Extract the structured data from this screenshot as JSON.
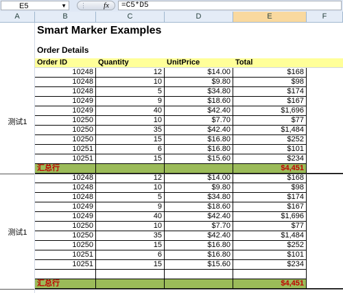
{
  "namebox": "E5",
  "formula": "=C5*D5",
  "columns": [
    "A",
    "B",
    "C",
    "D",
    "E",
    "F"
  ],
  "title": "Smart Marker Examples",
  "subtitle": "Order Details",
  "headers": {
    "order_id": "Order ID",
    "quantity": "Quantity",
    "unit_price": "UnitPrice",
    "total": "Total"
  },
  "groups": [
    {
      "label": "测试1",
      "rows": [
        {
          "id": "10248",
          "qty": "12",
          "price": "$14.00",
          "total": "$168"
        },
        {
          "id": "10248",
          "qty": "10",
          "price": "$9.80",
          "total": "$98"
        },
        {
          "id": "10248",
          "qty": "5",
          "price": "$34.80",
          "total": "$174"
        },
        {
          "id": "10249",
          "qty": "9",
          "price": "$18.60",
          "total": "$167"
        },
        {
          "id": "10249",
          "qty": "40",
          "price": "$42.40",
          "total": "$1,696"
        },
        {
          "id": "10250",
          "qty": "10",
          "price": "$7.70",
          "total": "$77"
        },
        {
          "id": "10250",
          "qty": "35",
          "price": "$42.40",
          "total": "$1,484"
        },
        {
          "id": "10250",
          "qty": "15",
          "price": "$16.80",
          "total": "$252"
        },
        {
          "id": "10251",
          "qty": "6",
          "price": "$16.80",
          "total": "$101"
        },
        {
          "id": "10251",
          "qty": "15",
          "price": "$15.60",
          "total": "$234"
        }
      ],
      "total_label": "汇总行",
      "total_value": "$4,451"
    },
    {
      "label": "测试1",
      "rows": [
        {
          "id": "10248",
          "qty": "12",
          "price": "$14.00",
          "total": "$168"
        },
        {
          "id": "10248",
          "qty": "10",
          "price": "$9.80",
          "total": "$98"
        },
        {
          "id": "10248",
          "qty": "5",
          "price": "$34.80",
          "total": "$174"
        },
        {
          "id": "10249",
          "qty": "9",
          "price": "$18.60",
          "total": "$167"
        },
        {
          "id": "10249",
          "qty": "40",
          "price": "$42.40",
          "total": "$1,696"
        },
        {
          "id": "10250",
          "qty": "10",
          "price": "$7.70",
          "total": "$77"
        },
        {
          "id": "10250",
          "qty": "35",
          "price": "$42.40",
          "total": "$1,484"
        },
        {
          "id": "10250",
          "qty": "15",
          "price": "$16.80",
          "total": "$252"
        },
        {
          "id": "10251",
          "qty": "6",
          "price": "$16.80",
          "total": "$101"
        },
        {
          "id": "10251",
          "qty": "15",
          "price": "$15.60",
          "total": "$234"
        }
      ],
      "total_label": "汇总行",
      "total_value": "$4,451"
    }
  ],
  "colors": {
    "header_fill": "#ffff99",
    "total_fill": "#9bbb59",
    "total_text": "#c00000",
    "selected_col": "#f9d99f"
  }
}
